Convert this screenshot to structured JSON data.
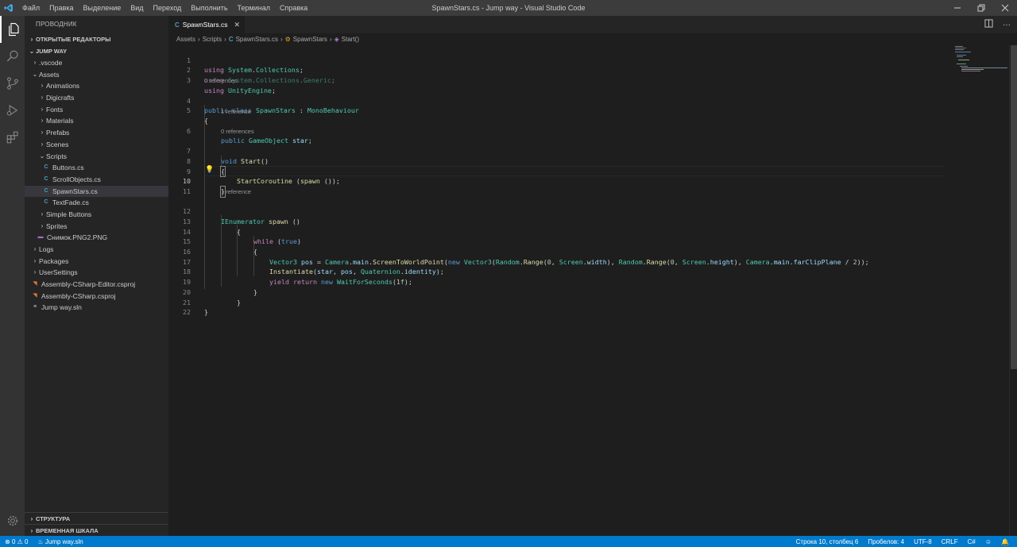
{
  "window": {
    "title": "SpawnStars.cs - Jump way - Visual Studio Code"
  },
  "menu": [
    "Файл",
    "Правка",
    "Выделение",
    "Вид",
    "Переход",
    "Выполнить",
    "Терминал",
    "Справка"
  ],
  "sidebar": {
    "title": "ПРОВОДНИК",
    "open_editors": "ОТКРЫТЫЕ РЕДАКТОРЫ",
    "project": "JUMP WAY",
    "tree": [
      {
        "label": ".vscode"
      },
      {
        "label": "Assets"
      },
      {
        "label": "Animations"
      },
      {
        "label": "Digicrafts"
      },
      {
        "label": "Fonts"
      },
      {
        "label": "Materials"
      },
      {
        "label": "Prefabs"
      },
      {
        "label": "Scenes"
      },
      {
        "label": "Scripts"
      },
      {
        "label": "Buttons.cs"
      },
      {
        "label": "ScrollObjects.cs"
      },
      {
        "label": "SpawnStars.cs"
      },
      {
        "label": "TextFade.cs"
      },
      {
        "label": "Simple Buttons"
      },
      {
        "label": "Sprites"
      },
      {
        "label": "Снимок.PNG2.PNG"
      },
      {
        "label": "Logs"
      },
      {
        "label": "Packages"
      },
      {
        "label": "UserSettings"
      },
      {
        "label": "Assembly-CSharp-Editor.csproj"
      },
      {
        "label": "Assembly-CSharp.csproj"
      },
      {
        "label": "Jump way.sln"
      }
    ],
    "outline": "СТРУКТУРА",
    "timeline": "ВРЕМЕННАЯ ШКАЛА"
  },
  "tab": {
    "label": "SpawnStars.cs",
    "icon": "C#"
  },
  "breadcrumb": [
    "Assets",
    "Scripts",
    "SpawnStars.cs",
    "SpawnStars",
    "Start()"
  ],
  "codelens": {
    "l4": "0 references",
    "l6": "1 reference",
    "l7": "0 references",
    "l12": "1 reference"
  },
  "code": {
    "l1a": "using",
    "l1b": "System",
    "l1c": ".",
    "l1d": "Collections",
    "l1e": ";",
    "l2a": "using",
    "l2b": "System",
    "l2c": ".",
    "l2d": "Collections",
    "l2e": ".",
    "l2f": "Generic",
    "l2g": ";",
    "l3a": "using",
    "l3b": "UnityEngine",
    "l3c": ";",
    "l4a": "public",
    "l4b": "class",
    "l4c": "SpawnStars",
    "l4d": " : ",
    "l4e": "MonoBehaviour",
    "l5": "{",
    "l6a": "public",
    "l6b": "GameObject",
    "l6c": "star",
    "l6d": ";",
    "l7a": "void",
    "l7b": "Start",
    "l7c": "()",
    "l8": "{",
    "l9a": "StartCoroutine",
    "l9b": " (",
    "l9c": "spawn",
    "l9d": " ());",
    "l10": "}",
    "l12a": "IEnumerator",
    "l12b": "spawn",
    "l12c": " ()",
    "l13": "{",
    "l14a": "while",
    "l14b": " (",
    "l14c": "true",
    "l14d": ")",
    "l15": "{",
    "l16a": "Vector3",
    "l16b": "pos",
    "l16c": " = ",
    "l16d": "Camera",
    "l16e": ".",
    "l16f": "main",
    "l16g": ".",
    "l16h": "ScreenToWorldPoint",
    "l16i": "(",
    "l16j": "new",
    "l16k": "Vector3",
    "l16l": "(",
    "l16m": "Random",
    "l16n": ".",
    "l16o": "Range",
    "l16p": "(",
    "l16q": "0",
    "l16r": ", ",
    "l16s": "Screen",
    "l16t": ".",
    "l16u": "width",
    "l16v": "), ",
    "l16w": "Random",
    "l16x": ".",
    "l16y": "Range",
    "l16z": "(",
    "l16A": "0",
    "l16B": ", ",
    "l16C": "Screen",
    "l16D": ".",
    "l16E": "height",
    "l16F": "), ",
    "l16G": "Camera",
    "l16H": ".",
    "l16I": "main",
    "l16J": ".",
    "l16K": "farClipPlane",
    "l16L": " / ",
    "l16M": "2",
    "l16N": "));",
    "l17a": "Instantiate",
    "l17b": "(",
    "l17c": "star",
    "l17d": ", ",
    "l17e": "pos",
    "l17f": ", ",
    "l17g": "Quaternion",
    "l17h": ".",
    "l17i": "identity",
    "l17j": ");",
    "l18a": "yield",
    "l18b": "return",
    "l18c": "new",
    "l18d": "WaitForSeconds",
    "l18e": "(",
    "l18f": "1f",
    "l18g": ");",
    "l19": "}",
    "l20": "}",
    "l21": "}"
  },
  "line_numbers": [
    "1",
    "2",
    "3",
    "4",
    "5",
    "6",
    "7",
    "8",
    "9",
    "10",
    "11",
    "12",
    "13",
    "14",
    "15",
    "16",
    "17",
    "18",
    "19",
    "20",
    "21",
    "22"
  ],
  "status": {
    "errors": "0",
    "warnings": "0",
    "solution": "Jump way.sln",
    "position": "Строка 10, столбец 6",
    "spaces": "Пробелов: 4",
    "encoding": "UTF-8",
    "eol": "CRLF",
    "language": "C#"
  },
  "colors": {
    "accent": "#007acc",
    "keyword": "#569cd6",
    "control": "#c586c0",
    "type": "#4ec9b0",
    "function": "#dcdcaa",
    "variable": "#9cdcfe"
  }
}
